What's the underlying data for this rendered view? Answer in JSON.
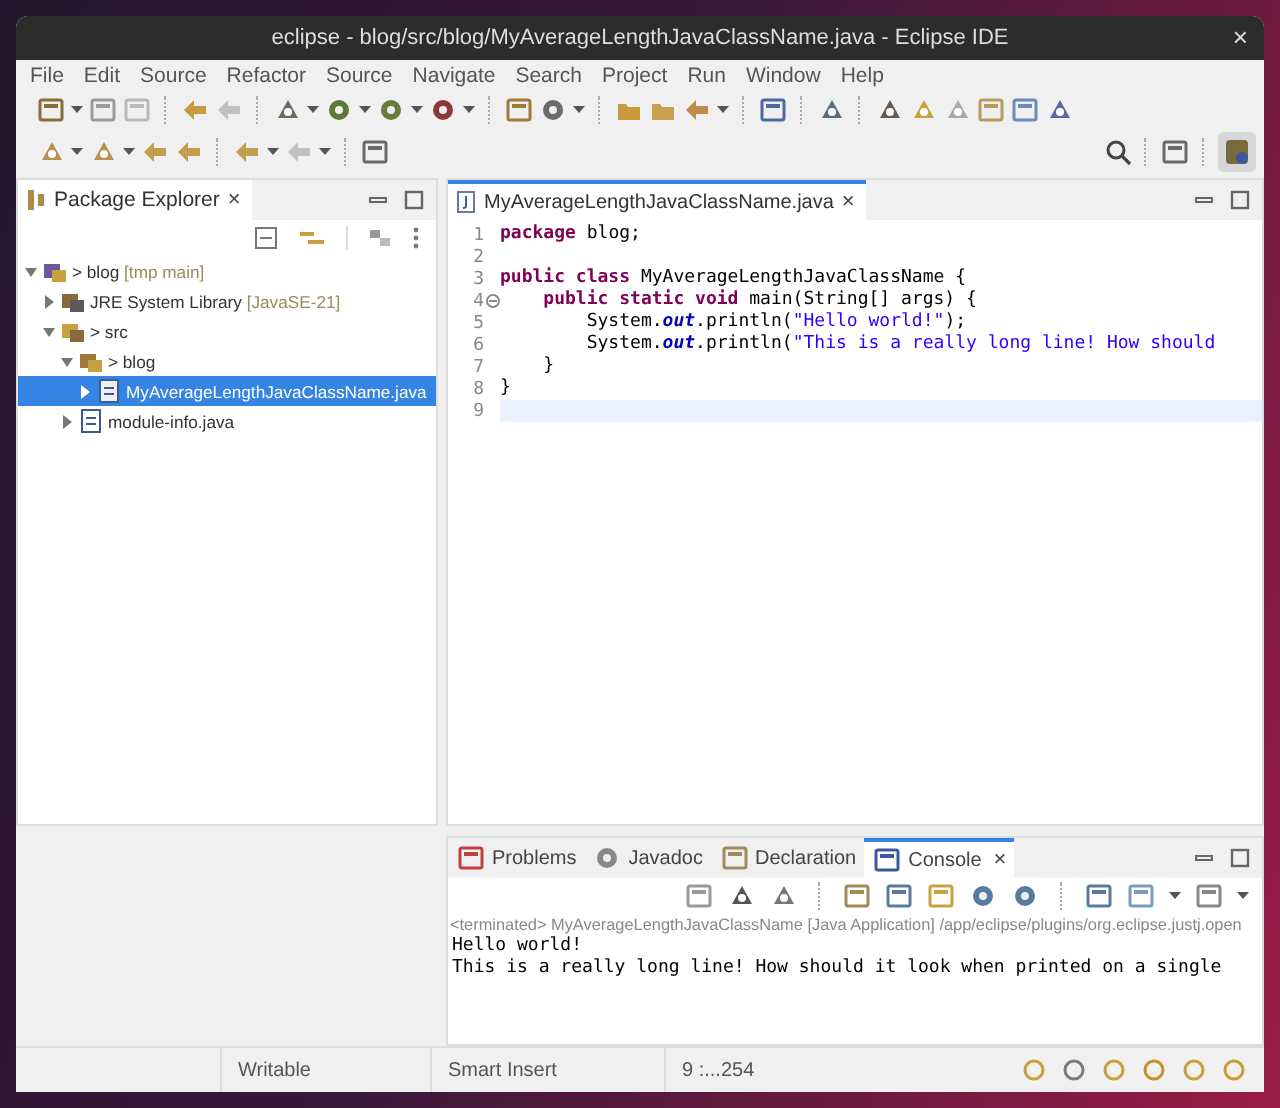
{
  "window": {
    "title": "eclipse - blog/src/blog/MyAverageLengthJavaClassName.java - Eclipse IDE",
    "close": "×"
  },
  "menu": [
    "File",
    "Edit",
    "Source",
    "Refactor",
    "Source",
    "Navigate",
    "Search",
    "Project",
    "Run",
    "Window",
    "Help"
  ],
  "explorer": {
    "tab": {
      "label": "Package Explorer",
      "close": "×"
    },
    "tree": [
      {
        "kind": "project",
        "label": "> blog",
        "decoration": " [tmp main]",
        "expanded": true,
        "selected": false,
        "children": [
          {
            "kind": "library",
            "label": "JRE System Library",
            "decoration": " [JavaSE-21]",
            "expanded": false,
            "selected": false
          },
          {
            "kind": "source-folder",
            "label": "> src",
            "expanded": true,
            "selected": false,
            "children": [
              {
                "kind": "package",
                "label": "> blog",
                "expanded": true,
                "selected": false,
                "children": [
                  {
                    "kind": "java-file",
                    "label": "MyAverageLengthJavaClassName.java",
                    "expanded": false,
                    "selected": true
                  }
                ]
              },
              {
                "kind": "module-file",
                "label": "module-info.java",
                "expanded": false,
                "selected": false
              }
            ]
          }
        ]
      }
    ]
  },
  "editor": {
    "tab": {
      "label": "MyAverageLengthJavaClassName.java",
      "close": "×"
    },
    "lines": [
      {
        "number": "1",
        "fold": false,
        "current": false,
        "segments": [
          {
            "text": "package",
            "kind": "keyword"
          },
          {
            "text": " blog;",
            "kind": "plain"
          }
        ]
      },
      {
        "number": "2",
        "fold": false,
        "current": false
      },
      {
        "number": "3",
        "fold": false,
        "current": false,
        "segments": [
          {
            "text": "public class",
            "kind": "keyword"
          },
          {
            "text": " MyAverageLengthJavaClassName {",
            "kind": "plain"
          }
        ]
      },
      {
        "number": "4",
        "fold": true,
        "current": false,
        "segments": [
          {
            "text": "    public static void",
            "kind": "keyword"
          },
          {
            "text": " main(String[] args) {",
            "kind": "plain"
          }
        ]
      },
      {
        "number": "5",
        "fold": false,
        "current": false,
        "segments": [
          {
            "text": "        System.",
            "kind": "plain"
          },
          {
            "text": "out",
            "kind": "field"
          },
          {
            "text": ".println(",
            "kind": "plain"
          },
          {
            "text": "\"Hello world!\"",
            "kind": "string"
          },
          {
            "text": ");",
            "kind": "plain"
          }
        ]
      },
      {
        "number": "6",
        "fold": false,
        "current": false,
        "segments": [
          {
            "text": "        System.",
            "kind": "plain"
          },
          {
            "text": "out",
            "kind": "field"
          },
          {
            "text": ".println(",
            "kind": "plain"
          },
          {
            "text": "\"This is a really long line! How should",
            "kind": "string"
          }
        ]
      },
      {
        "number": "7",
        "fold": false,
        "current": false,
        "segments": [
          {
            "text": "    }",
            "kind": "plain"
          }
        ]
      },
      {
        "number": "8",
        "fold": false,
        "current": false,
        "segments": [
          {
            "text": "}",
            "kind": "plain"
          }
        ]
      },
      {
        "number": "9",
        "fold": false,
        "current": true
      }
    ]
  },
  "bottom": {
    "tabs": [
      {
        "kind": "problems",
        "label": "Problems",
        "selected": false
      },
      {
        "kind": "javadoc",
        "label": "Javadoc",
        "selected": false
      },
      {
        "kind": "declaration",
        "label": "Declaration",
        "selected": false
      },
      {
        "kind": "console",
        "label": "Console",
        "selected": true,
        "close": "×"
      }
    ],
    "console": {
      "header": "<terminated> MyAverageLengthJavaClassName [Java Application] /app/eclipse/plugins/org.eclipse.justj.open",
      "output": [
        "Hello world!",
        "This is a really long line! How should it look when printed on a single"
      ]
    }
  },
  "status_bar": [
    "Writable",
    "Smart Insert",
    "9 :...254"
  ]
}
